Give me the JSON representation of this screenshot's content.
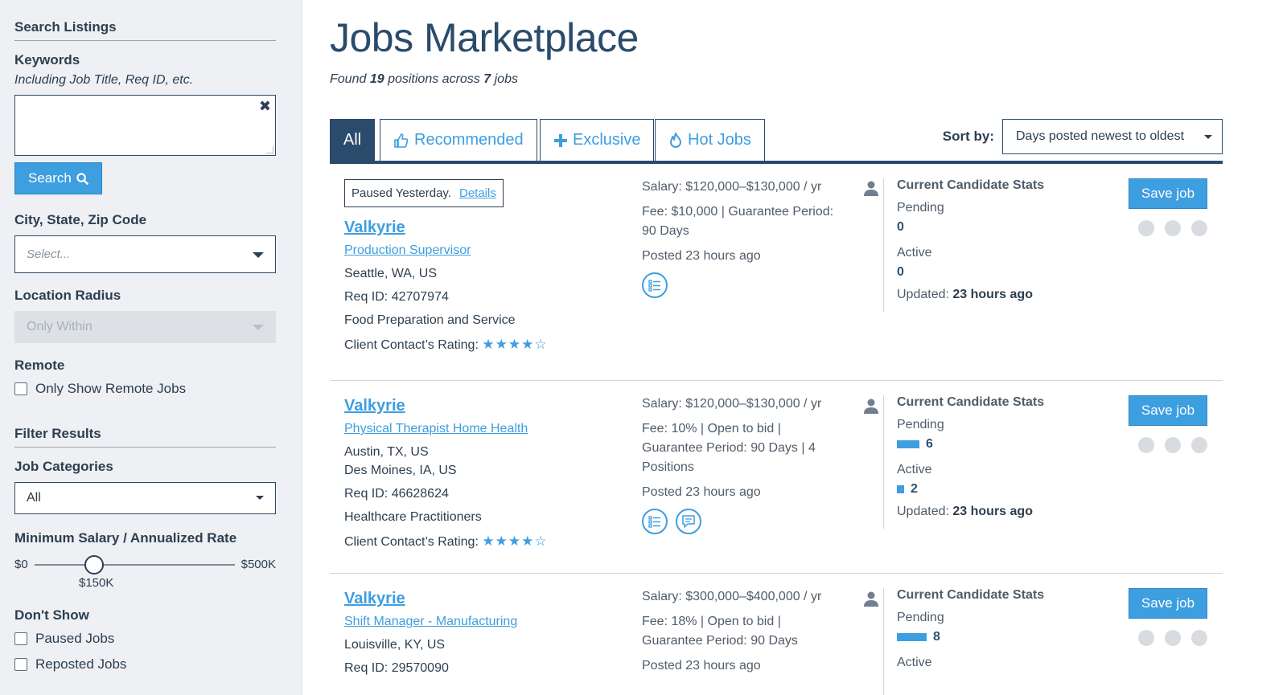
{
  "sidebar": {
    "search_title": "Search Listings",
    "keywords_label": "Keywords",
    "keywords_hint": "Including Job Title, Req ID, etc.",
    "keywords_value": "",
    "search_button": "Search",
    "location_label": "City, State, Zip Code",
    "location_placeholder": "Select...",
    "radius_label": "Location Radius",
    "radius_value": "Only Within",
    "remote_label": "Remote",
    "remote_checkbox": "Only Show Remote Jobs",
    "filter_title": "Filter Results",
    "categories_label": "Job Categories",
    "categories_value": "All",
    "salary_label": "Minimum Salary / Annualized Rate",
    "salary_min": "$0",
    "salary_max": "$500K",
    "salary_value": "$150K",
    "salary_fraction": 0.3,
    "dont_show_label": "Don't Show",
    "paused_checkbox": "Paused Jobs",
    "reposted_checkbox": "Reposted Jobs"
  },
  "header": {
    "title": "Jobs Marketplace",
    "found_prefix": "Found",
    "positions": "19",
    "positions_mid": "positions across",
    "jobs": "7",
    "jobs_suffix": "jobs"
  },
  "tabs": {
    "all": "All",
    "recommended": "Recommended",
    "exclusive": "Exclusive",
    "hot": "Hot Jobs"
  },
  "sort": {
    "label": "Sort by:",
    "value": "Days posted newest to oldest"
  },
  "stats_common": {
    "title": "Current Candidate Stats",
    "pending_label": "Pending",
    "active_label": "Active",
    "updated_label": "Updated:",
    "save_label": "Save job",
    "rating_label": "Client Contact’s Rating:"
  },
  "jobs": [
    {
      "paused_text": "Paused Yesterday.",
      "details_link": "Details",
      "company": "Valkyrie",
      "title": "Production Supervisor",
      "location": "Seattle, WA, US",
      "req_id": "Req ID: 42707974",
      "category": "Food Preparation and Service",
      "stars": "★★★★☆",
      "rating": 4,
      "salary": "Salary: $120,000–$130,000 / yr",
      "fee": "Fee: $10,000 | Guarantee Period: 90 Days",
      "posted": "Posted 23 hours ago",
      "pending": "0",
      "active": "0",
      "updated": "23 hours ago"
    },
    {
      "company": "Valkyrie",
      "title": "Physical Therapist Home Health",
      "location": "Austin, TX, US",
      "location2": "Des Moines, IA, US",
      "req_id": "Req ID: 46628624",
      "category": "Healthcare Practitioners",
      "stars": "★★★★☆",
      "rating": 4,
      "salary": "Salary: $120,000–$130,000 / yr",
      "fee": "Fee: 10% | Open to bid | Guarantee Period: 90 Days | 4 Positions",
      "posted": "Posted 23 hours ago",
      "pending": "6",
      "active": "2",
      "updated": "23 hours ago"
    },
    {
      "company": "Valkyrie",
      "title": "Shift Manager - Manufacturing",
      "location": "Louisville, KY, US",
      "req_id": "Req ID: 29570090",
      "salary": "Salary: $300,000–$400,000 / yr",
      "fee": "Fee: 18% | Open to bid | Guarantee Period: 90 Days",
      "posted": "Posted 23 hours ago",
      "pending": "8"
    }
  ],
  "colors": {
    "accent": "#3d9ee0",
    "navy": "#2a4b6b",
    "sidebar_bg": "#eef0f3"
  }
}
